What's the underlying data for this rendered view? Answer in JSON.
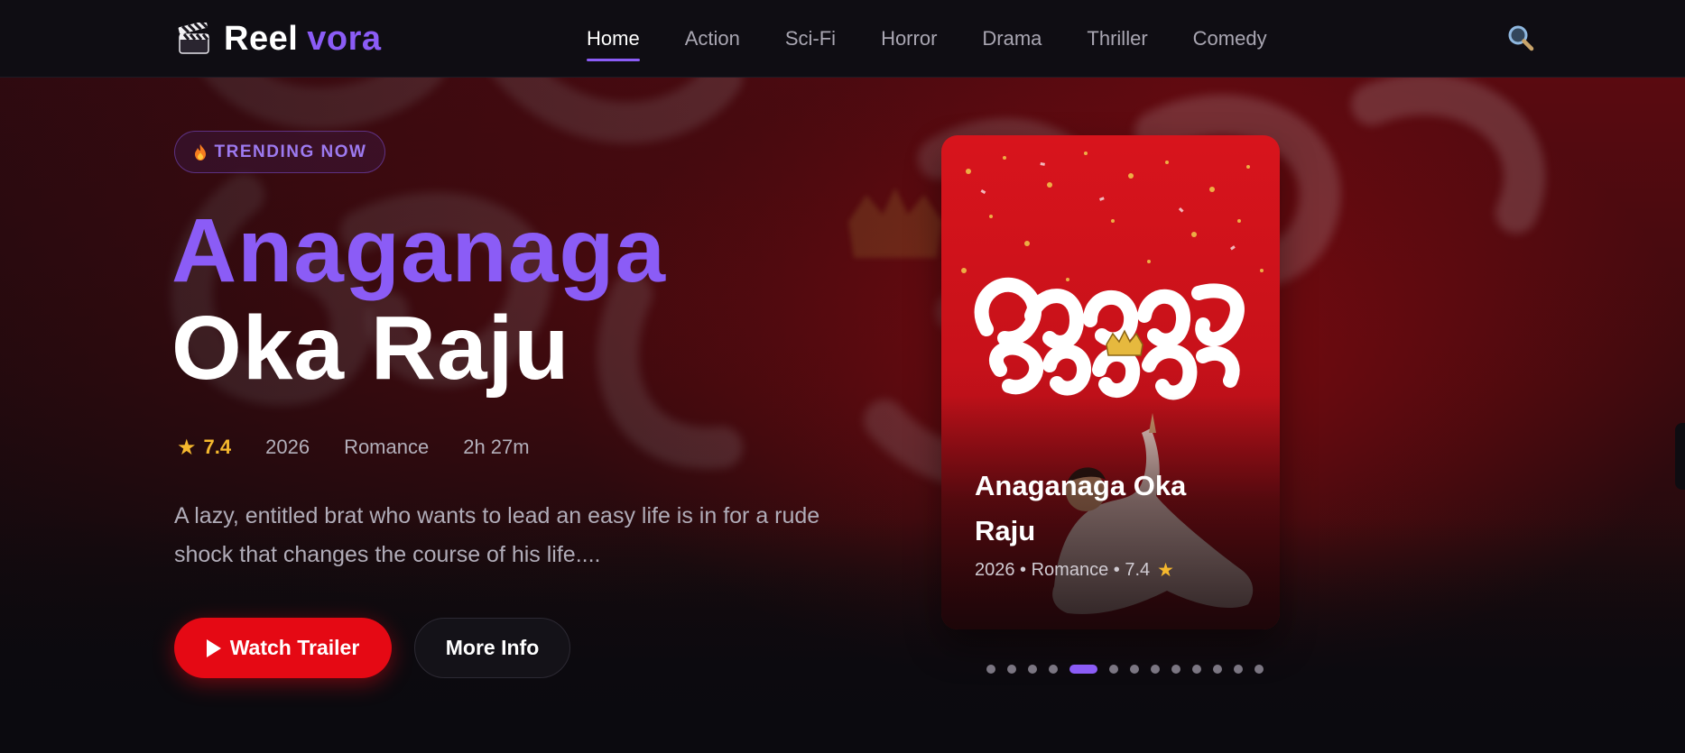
{
  "brand": {
    "logo_icon": "clapperboard-icon",
    "name_part1": "Reel",
    "name_part2": "vora",
    "accent_color": "#8b5cf6"
  },
  "nav": {
    "items": [
      {
        "label": "Home",
        "active": true
      },
      {
        "label": "Action",
        "active": false
      },
      {
        "label": "Sci-Fi",
        "active": false
      },
      {
        "label": "Horror",
        "active": false
      },
      {
        "label": "Drama",
        "active": false
      },
      {
        "label": "Thriller",
        "active": false
      },
      {
        "label": "Comedy",
        "active": false
      }
    ],
    "search_icon": "search-icon"
  },
  "hero": {
    "badge_icon": "flame-icon",
    "badge_label": "TRENDING NOW",
    "title_line1": "Anaganaga",
    "title_line2": "Oka Raju",
    "rating": "7.4",
    "year": "2026",
    "genre": "Romance",
    "duration": "2h 27m",
    "description": "A lazy, entitled brat who wants to lead an easy life is in for a rude shock that changes the course of his life....",
    "primary_button": "Watch Trailer",
    "secondary_button": "More Info",
    "primary_color": "#e50914"
  },
  "poster": {
    "title": "Anaganaga Oka Raju",
    "meta_text": "2026 • Romance • 7.4",
    "star_icon": "star-icon"
  },
  "carousel": {
    "total": 13,
    "active_index": 4
  }
}
